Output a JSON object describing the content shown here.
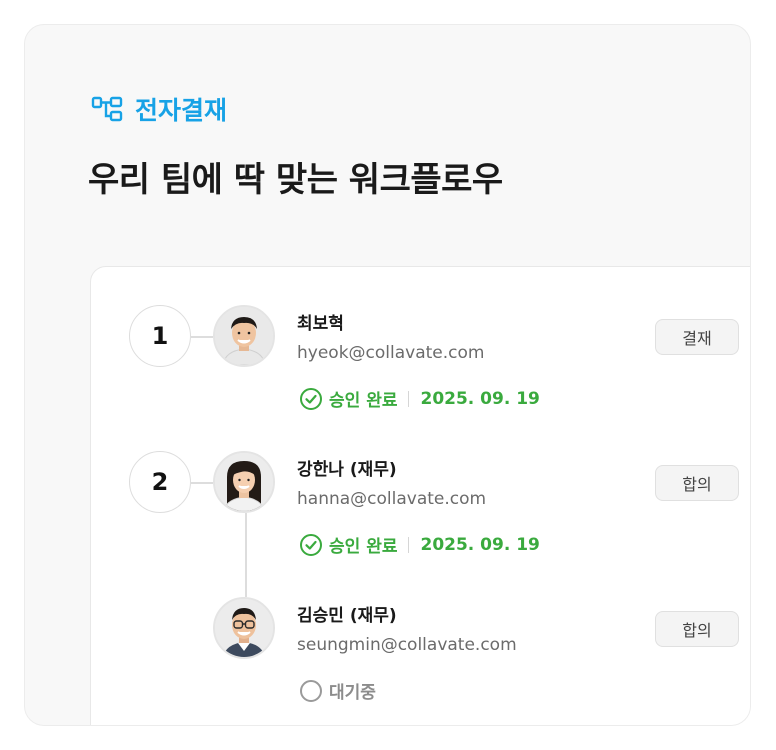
{
  "header": {
    "section_label": "전자결재",
    "headline": "우리 팀에 딱 맞는 워크플로우"
  },
  "workflow": {
    "steps": [
      {
        "number": "1",
        "approvers": [
          {
            "name": "최보혁",
            "email": "hyeok@collavate.com",
            "role": "결재",
            "status": "승인 완료",
            "date": "2025. 09. 19"
          }
        ]
      },
      {
        "number": "2",
        "approvers": [
          {
            "name": "강한나 (재무)",
            "email": "hanna@collavate.com",
            "role": "합의",
            "status": "승인 완료",
            "date": "2025. 09. 19"
          },
          {
            "name": "김승민 (재무)",
            "email": "seungmin@collavate.com",
            "role": "합의",
            "status": "대기중"
          }
        ]
      }
    ]
  },
  "colors": {
    "accent": "#17a2e6",
    "approved": "#3aaa3e",
    "pending": "#8c8c8c"
  },
  "icons": {
    "section": "workflow-icon",
    "approved": "check-circle-icon",
    "pending": "empty-circle-icon"
  }
}
